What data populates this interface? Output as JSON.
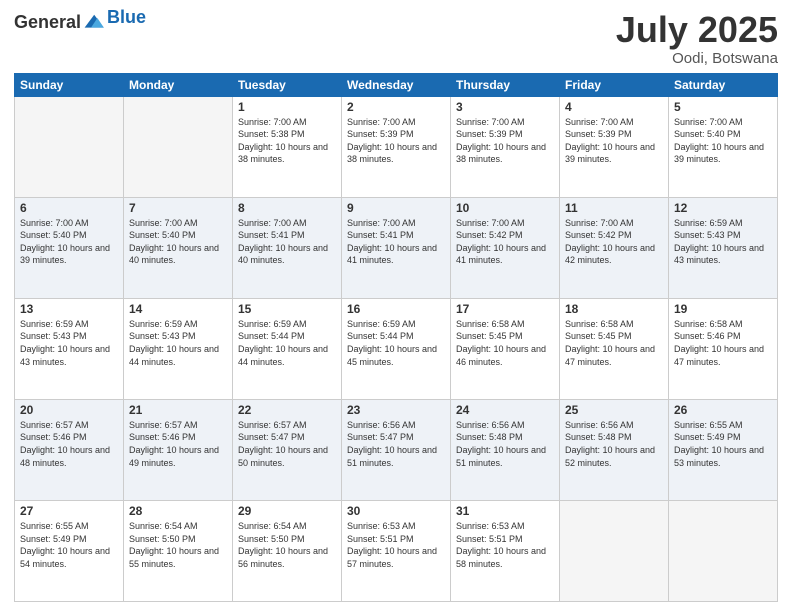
{
  "logo": {
    "text_general": "General",
    "text_blue": "Blue"
  },
  "title": {
    "month_year": "July 2025",
    "location": "Oodi, Botswana"
  },
  "days_of_week": [
    "Sunday",
    "Monday",
    "Tuesday",
    "Wednesday",
    "Thursday",
    "Friday",
    "Saturday"
  ],
  "weeks": [
    [
      {
        "num": "",
        "info": ""
      },
      {
        "num": "",
        "info": ""
      },
      {
        "num": "1",
        "info": "Sunrise: 7:00 AM\nSunset: 5:38 PM\nDaylight: 10 hours and 38 minutes."
      },
      {
        "num": "2",
        "info": "Sunrise: 7:00 AM\nSunset: 5:39 PM\nDaylight: 10 hours and 38 minutes."
      },
      {
        "num": "3",
        "info": "Sunrise: 7:00 AM\nSunset: 5:39 PM\nDaylight: 10 hours and 38 minutes."
      },
      {
        "num": "4",
        "info": "Sunrise: 7:00 AM\nSunset: 5:39 PM\nDaylight: 10 hours and 39 minutes."
      },
      {
        "num": "5",
        "info": "Sunrise: 7:00 AM\nSunset: 5:40 PM\nDaylight: 10 hours and 39 minutes."
      }
    ],
    [
      {
        "num": "6",
        "info": "Sunrise: 7:00 AM\nSunset: 5:40 PM\nDaylight: 10 hours and 39 minutes."
      },
      {
        "num": "7",
        "info": "Sunrise: 7:00 AM\nSunset: 5:40 PM\nDaylight: 10 hours and 40 minutes."
      },
      {
        "num": "8",
        "info": "Sunrise: 7:00 AM\nSunset: 5:41 PM\nDaylight: 10 hours and 40 minutes."
      },
      {
        "num": "9",
        "info": "Sunrise: 7:00 AM\nSunset: 5:41 PM\nDaylight: 10 hours and 41 minutes."
      },
      {
        "num": "10",
        "info": "Sunrise: 7:00 AM\nSunset: 5:42 PM\nDaylight: 10 hours and 41 minutes."
      },
      {
        "num": "11",
        "info": "Sunrise: 7:00 AM\nSunset: 5:42 PM\nDaylight: 10 hours and 42 minutes."
      },
      {
        "num": "12",
        "info": "Sunrise: 6:59 AM\nSunset: 5:43 PM\nDaylight: 10 hours and 43 minutes."
      }
    ],
    [
      {
        "num": "13",
        "info": "Sunrise: 6:59 AM\nSunset: 5:43 PM\nDaylight: 10 hours and 43 minutes."
      },
      {
        "num": "14",
        "info": "Sunrise: 6:59 AM\nSunset: 5:43 PM\nDaylight: 10 hours and 44 minutes."
      },
      {
        "num": "15",
        "info": "Sunrise: 6:59 AM\nSunset: 5:44 PM\nDaylight: 10 hours and 44 minutes."
      },
      {
        "num": "16",
        "info": "Sunrise: 6:59 AM\nSunset: 5:44 PM\nDaylight: 10 hours and 45 minutes."
      },
      {
        "num": "17",
        "info": "Sunrise: 6:58 AM\nSunset: 5:45 PM\nDaylight: 10 hours and 46 minutes."
      },
      {
        "num": "18",
        "info": "Sunrise: 6:58 AM\nSunset: 5:45 PM\nDaylight: 10 hours and 47 minutes."
      },
      {
        "num": "19",
        "info": "Sunrise: 6:58 AM\nSunset: 5:46 PM\nDaylight: 10 hours and 47 minutes."
      }
    ],
    [
      {
        "num": "20",
        "info": "Sunrise: 6:57 AM\nSunset: 5:46 PM\nDaylight: 10 hours and 48 minutes."
      },
      {
        "num": "21",
        "info": "Sunrise: 6:57 AM\nSunset: 5:46 PM\nDaylight: 10 hours and 49 minutes."
      },
      {
        "num": "22",
        "info": "Sunrise: 6:57 AM\nSunset: 5:47 PM\nDaylight: 10 hours and 50 minutes."
      },
      {
        "num": "23",
        "info": "Sunrise: 6:56 AM\nSunset: 5:47 PM\nDaylight: 10 hours and 51 minutes."
      },
      {
        "num": "24",
        "info": "Sunrise: 6:56 AM\nSunset: 5:48 PM\nDaylight: 10 hours and 51 minutes."
      },
      {
        "num": "25",
        "info": "Sunrise: 6:56 AM\nSunset: 5:48 PM\nDaylight: 10 hours and 52 minutes."
      },
      {
        "num": "26",
        "info": "Sunrise: 6:55 AM\nSunset: 5:49 PM\nDaylight: 10 hours and 53 minutes."
      }
    ],
    [
      {
        "num": "27",
        "info": "Sunrise: 6:55 AM\nSunset: 5:49 PM\nDaylight: 10 hours and 54 minutes."
      },
      {
        "num": "28",
        "info": "Sunrise: 6:54 AM\nSunset: 5:50 PM\nDaylight: 10 hours and 55 minutes."
      },
      {
        "num": "29",
        "info": "Sunrise: 6:54 AM\nSunset: 5:50 PM\nDaylight: 10 hours and 56 minutes."
      },
      {
        "num": "30",
        "info": "Sunrise: 6:53 AM\nSunset: 5:51 PM\nDaylight: 10 hours and 57 minutes."
      },
      {
        "num": "31",
        "info": "Sunrise: 6:53 AM\nSunset: 5:51 PM\nDaylight: 10 hours and 58 minutes."
      },
      {
        "num": "",
        "info": ""
      },
      {
        "num": "",
        "info": ""
      }
    ]
  ]
}
